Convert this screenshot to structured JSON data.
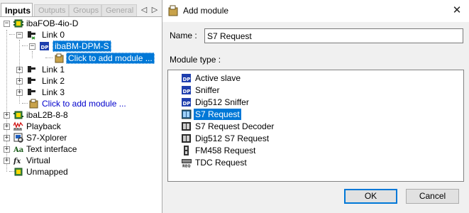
{
  "tabs": {
    "inputs": "Inputs",
    "outputs": "Outputs",
    "groups": "Groups",
    "general": "General"
  },
  "tree": {
    "ibafob": "ibaFOB-4io-D",
    "link0": "Link 0",
    "dpm": "ibaBM-DPM-S",
    "add_module_selected": "Click to add module ...",
    "link1": "Link 1",
    "link2": "Link 2",
    "link3": "Link 3",
    "add_module": "Click to add module ...",
    "ibal2b": "ibaL2B-8-8",
    "playback": "Playback",
    "s7xplorer": "S7-Xplorer",
    "text_interface": "Text interface",
    "virtual": "Virtual",
    "unmapped": "Unmapped"
  },
  "dialog": {
    "title": "Add module",
    "close_glyph": "✕",
    "name_label": "Name :",
    "name_value": "S7 Request",
    "module_type_label": "Module type :",
    "modules": [
      "Active slave",
      "Sniffer",
      "Dig512 Sniffer",
      "S7 Request",
      "S7 Request Decoder",
      "Dig512 S7 Request",
      "FM458 Request",
      "TDC Request"
    ],
    "selected_module": "S7 Request",
    "ok_label": "OK",
    "cancel_label": "Cancel"
  },
  "colors": {
    "selection": "#0078d7",
    "link_text": "#0000cc",
    "dialog_bg": "#f0f0f0"
  }
}
